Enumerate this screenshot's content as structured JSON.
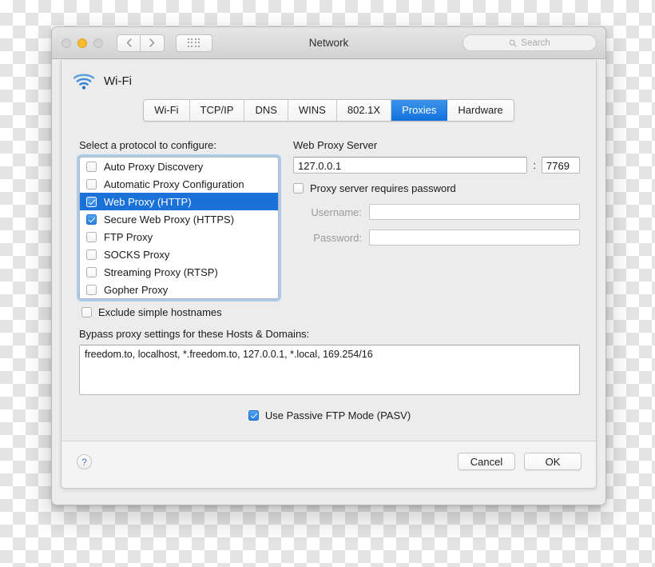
{
  "window": {
    "title": "Network",
    "traffic_lights": [
      "close",
      "minimize",
      "zoom"
    ],
    "search": {
      "placeholder": "Search",
      "icon": "search-icon"
    },
    "nav": {
      "back_icon": "chevron-left-icon",
      "forward_icon": "chevron-right-icon",
      "grid_icon": "grid-icon"
    }
  },
  "service": {
    "name": "Wi-Fi",
    "icon": "wifi-icon"
  },
  "tabs": [
    {
      "label": "Wi-Fi",
      "active": false
    },
    {
      "label": "TCP/IP",
      "active": false
    },
    {
      "label": "DNS",
      "active": false
    },
    {
      "label": "WINS",
      "active": false
    },
    {
      "label": "802.1X",
      "active": false
    },
    {
      "label": "Proxies",
      "active": true
    },
    {
      "label": "Hardware",
      "active": false
    }
  ],
  "protocols": {
    "label": "Select a protocol to configure:",
    "items": [
      {
        "label": "Auto Proxy Discovery",
        "checked": false,
        "selected": false
      },
      {
        "label": "Automatic Proxy Configuration",
        "checked": false,
        "selected": false
      },
      {
        "label": "Web Proxy (HTTP)",
        "checked": true,
        "selected": true
      },
      {
        "label": "Secure Web Proxy (HTTPS)",
        "checked": true,
        "selected": false
      },
      {
        "label": "FTP Proxy",
        "checked": false,
        "selected": false
      },
      {
        "label": "SOCKS Proxy",
        "checked": false,
        "selected": false
      },
      {
        "label": "Streaming Proxy (RTSP)",
        "checked": false,
        "selected": false
      },
      {
        "label": "Gopher Proxy",
        "checked": false,
        "selected": false
      }
    ],
    "exclude_simple_hostnames": {
      "label": "Exclude simple hostnames",
      "checked": false
    }
  },
  "proxy_server": {
    "title": "Web Proxy Server",
    "host_value": "127.0.0.1",
    "separator": ":",
    "port_value": "7769",
    "requires_password": {
      "label": "Proxy server requires password",
      "checked": false
    },
    "username": {
      "label": "Username:",
      "value": ""
    },
    "password": {
      "label": "Password:",
      "value": ""
    }
  },
  "bypass": {
    "label": "Bypass proxy settings for these Hosts & Domains:",
    "value": "freedom.to, localhost, *.freedom.to, 127.0.0.1, *.local, 169.254/16"
  },
  "passive_ftp": {
    "label": "Use Passive FTP Mode (PASV)",
    "checked": true
  },
  "footer": {
    "help_label": "?",
    "cancel_label": "Cancel",
    "ok_label": "OK"
  },
  "colors": {
    "accent_blue": "#1a72d8",
    "tab_active": "#1272dd",
    "checkbox_blue": "#2880e4",
    "amber": "#f9bc2e",
    "wifi_blue": "#3f8fd8"
  }
}
